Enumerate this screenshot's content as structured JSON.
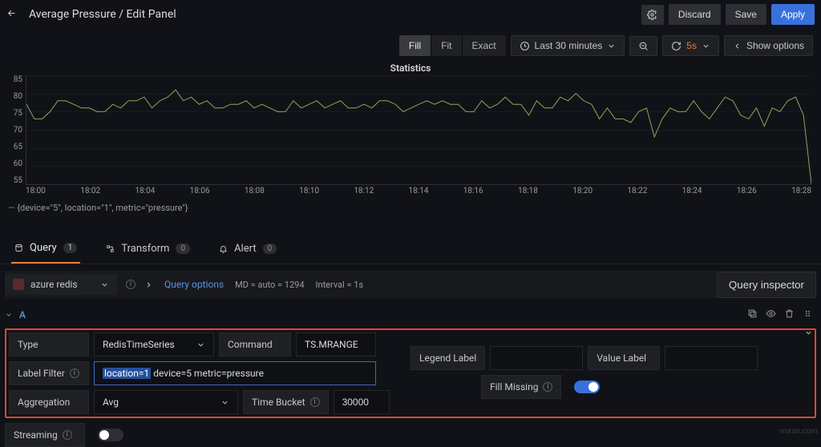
{
  "header": {
    "breadcrumb": "Average Pressure / Edit Panel",
    "discard": "Discard",
    "save": "Save",
    "apply": "Apply"
  },
  "display": {
    "modes": [
      {
        "label": "Fill",
        "active": true
      },
      {
        "label": "Fit",
        "active": false
      },
      {
        "label": "Exact",
        "active": false
      }
    ],
    "time_range": "Last 30 minutes",
    "refresh_value": "5s",
    "show_options": "Show options"
  },
  "chart_data": {
    "type": "line",
    "title": "Statistics",
    "xlabel": "",
    "ylabel": "",
    "ylim": [
      55,
      85
    ],
    "y_ticks": [
      85,
      80,
      75,
      70,
      65,
      60,
      55
    ],
    "x_ticks": [
      "18:00",
      "18:02",
      "18:04",
      "18:06",
      "18:08",
      "18:10",
      "18:12",
      "18:14",
      "18:16",
      "18:18",
      "18:20",
      "18:22",
      "18:24",
      "18:26",
      "18:28"
    ],
    "legend_label": "{device=\"5\", location=\"1\", metric=\"pressure\"}",
    "series": [
      {
        "name": "pressure",
        "values": [
          77,
          73,
          73,
          75,
          78,
          78,
          77,
          76,
          76,
          75,
          75,
          77,
          76,
          78,
          78,
          79,
          76,
          78,
          79,
          81,
          78,
          79,
          77,
          78,
          76,
          76,
          77,
          77,
          78,
          76,
          77,
          76,
          75,
          75,
          78,
          76,
          77,
          78,
          76,
          77,
          78,
          76,
          76,
          77,
          76,
          78,
          78,
          77,
          75,
          76,
          77,
          78,
          77,
          78,
          77,
          77,
          75,
          75,
          78,
          76,
          77,
          79,
          77,
          77,
          74,
          78,
          76,
          76,
          79,
          78,
          80,
          78,
          77,
          73,
          76,
          73,
          73,
          72,
          75,
          76,
          68,
          73,
          76,
          75,
          75,
          78,
          75,
          73,
          76,
          79,
          78,
          74,
          73,
          76,
          71,
          76,
          75,
          78,
          79,
          74,
          55
        ]
      }
    ]
  },
  "tabs": {
    "query": {
      "label": "Query",
      "count": "1"
    },
    "transform": {
      "label": "Transform",
      "count": "0"
    },
    "alert": {
      "label": "Alert",
      "count": "0"
    }
  },
  "query_opts": {
    "datasource": "azure redis",
    "link": "Query options",
    "md": "MD = auto = 1294",
    "interval": "Interval = 1s",
    "inspector": "Query inspector"
  },
  "query": {
    "name": "A",
    "type_label": "Type",
    "type_value": "RedisTimeSeries",
    "command_label": "Command",
    "command_value": "TS.MRANGE",
    "label_filter_label": "Label Filter",
    "label_filter_sel": "location=1",
    "label_filter_rest": " device=5 metric=pressure",
    "legend_label_label": "Legend Label",
    "legend_label_value": "",
    "value_label_label": "Value Label",
    "value_label_value": "",
    "agg_label": "Aggregation",
    "agg_value": "Avg",
    "time_bucket_label": "Time Bucket",
    "time_bucket_value": "30000",
    "fill_missing_label": "Fill Missing",
    "streaming_label": "Streaming"
  }
}
